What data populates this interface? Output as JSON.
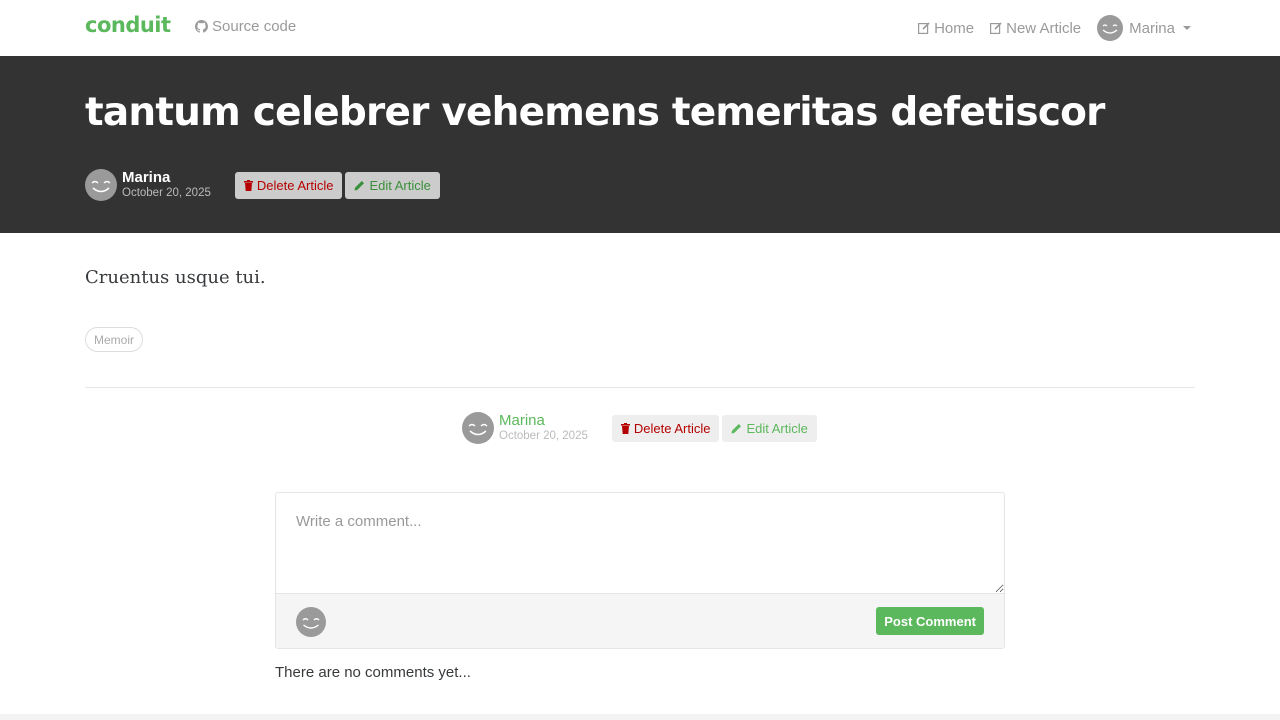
{
  "navbar": {
    "brand": "conduit",
    "source_code": "Source code",
    "home": "Home",
    "new_article": "New Article",
    "user": "Marina"
  },
  "article": {
    "title": "tantum celebrer vehemens temeritas defetiscor",
    "author": "Marina",
    "date": "October 20, 2025",
    "body": "Cruentus usque tui.",
    "tags": [
      "Memoir"
    ]
  },
  "actions": {
    "delete_label": "Delete Article",
    "edit_label": "Edit Article"
  },
  "comments": {
    "placeholder": "Write a comment...",
    "post_label": "Post Comment",
    "empty_text": "There are no comments yet..."
  },
  "colors": {
    "brand": "#5cb85c",
    "banner": "#333333",
    "danger": "#b40000"
  },
  "icons": [
    "github-icon",
    "edit-icon",
    "trash-icon",
    "pencil-icon",
    "avatar-smiley-icon",
    "caret-down-icon"
  ]
}
